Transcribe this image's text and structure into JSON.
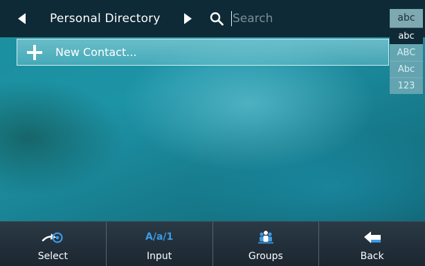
{
  "header": {
    "title": "Personal Directory",
    "prev_icon": "chevron-left-icon",
    "next_icon": "chevron-right-icon",
    "search_icon": "search-icon"
  },
  "search": {
    "placeholder": "Search",
    "value": ""
  },
  "new_contact": {
    "icon": "plus-icon",
    "label": "New Contact..."
  },
  "input_mode": {
    "current": "abc",
    "options": [
      "abc",
      "ABC",
      "Abc",
      "123"
    ],
    "selected": "abc"
  },
  "softkeys": [
    {
      "icon": "select-icon",
      "label": "Select"
    },
    {
      "icon": "input-mode-icon",
      "glyph": "A/a/1",
      "label": "Input"
    },
    {
      "icon": "groups-icon",
      "label": "Groups"
    },
    {
      "icon": "back-arrow-icon",
      "label": "Back"
    }
  ],
  "colors": {
    "topbar": "#0e2a36",
    "accent_blue": "#3d9be6",
    "background_teal": "#1a8e9c"
  }
}
